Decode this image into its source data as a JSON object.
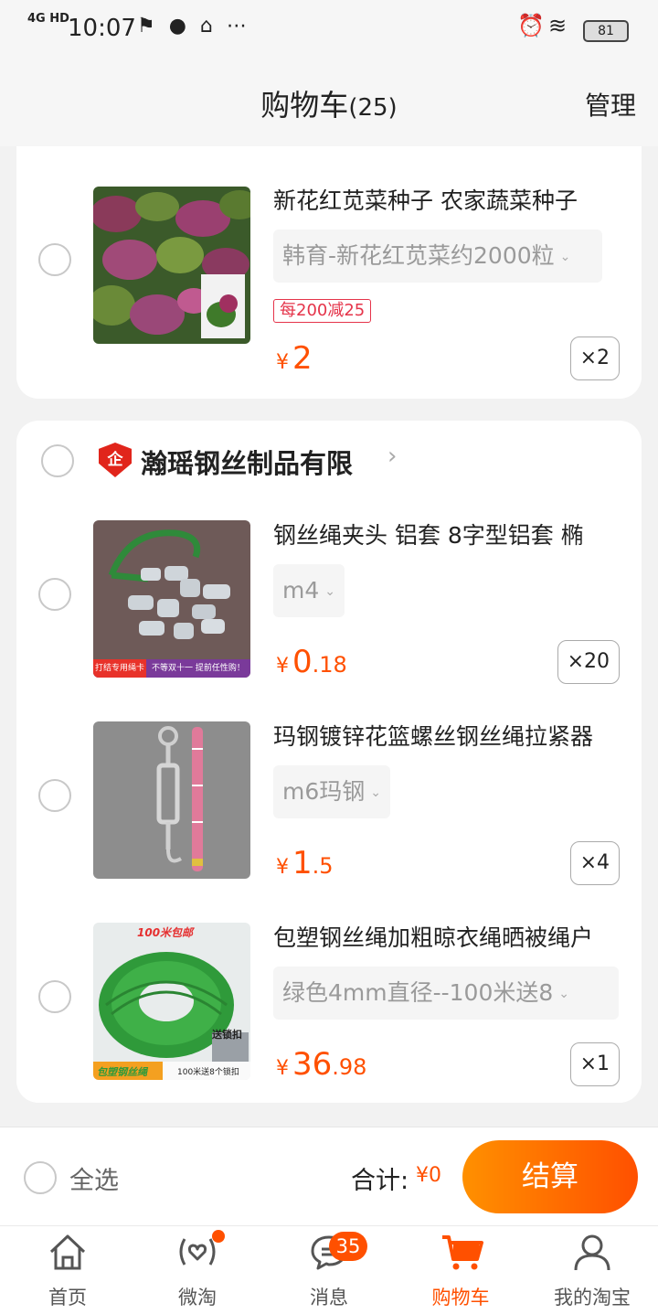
{
  "status_bar": {
    "network": "4G HD",
    "time": "10:07",
    "battery": "81"
  },
  "header": {
    "title": "购物车",
    "count": "(25)",
    "manage_label": "管理"
  },
  "colors": {
    "accent": "#ff5000",
    "promo": "#e5344a",
    "shop_badge": "#e1251b"
  },
  "cart": {
    "item0": {
      "title": "新花红苋菜种子 农家蔬菜种子",
      "sku": "韩育-新花红苋菜约2000粒",
      "promo": "每200减25",
      "price_symbol": "¥",
      "price_int": "2",
      "price_dec": "",
      "qty": "×2"
    },
    "shop": {
      "icon_text": "企",
      "name": "瀚瑶钢丝制品有限",
      "arrow": "›"
    },
    "items": [
      {
        "title": "钢丝绳夹头 铝套 8字型铝套 椭",
        "sku": "m4",
        "price_symbol": "¥",
        "price_int": "0",
        "price_dec": ".18",
        "qty": "×20",
        "thumb_caption_left": "打结专用绳卡",
        "thumb_caption_right": "不等双十一 提前任性购！"
      },
      {
        "title": "玛钢镀锌花篮螺丝钢丝绳拉紧器",
        "sku": "m6玛钢",
        "price_symbol": "¥",
        "price_int": "1",
        "price_dec": ".5",
        "qty": "×4"
      },
      {
        "title": "包塑钢丝绳加粗晾衣绳晒被绳户",
        "sku": "绿色4mm直径--100米送8",
        "price_symbol": "¥",
        "price_int": "36",
        "price_dec": ".98",
        "qty": "×1",
        "thumb_caption_top": "100米包邮",
        "thumb_caption_mid": "送锁扣",
        "thumb_caption_left": "包塑钢丝绳",
        "thumb_caption_right": "100米送8个锁扣"
      }
    ]
  },
  "bottom_bar": {
    "select_all": "全选",
    "total_label": "合计:",
    "total_value": "¥0",
    "checkout": "结算"
  },
  "tabs": [
    {
      "label": "首页",
      "icon": "home-icon"
    },
    {
      "label": "微淘",
      "icon": "weitao-icon"
    },
    {
      "label": "消息",
      "icon": "message-icon",
      "badge": "35"
    },
    {
      "label": "购物车",
      "icon": "cart-icon",
      "active": true
    },
    {
      "label": "我的淘宝",
      "icon": "profile-icon"
    }
  ]
}
